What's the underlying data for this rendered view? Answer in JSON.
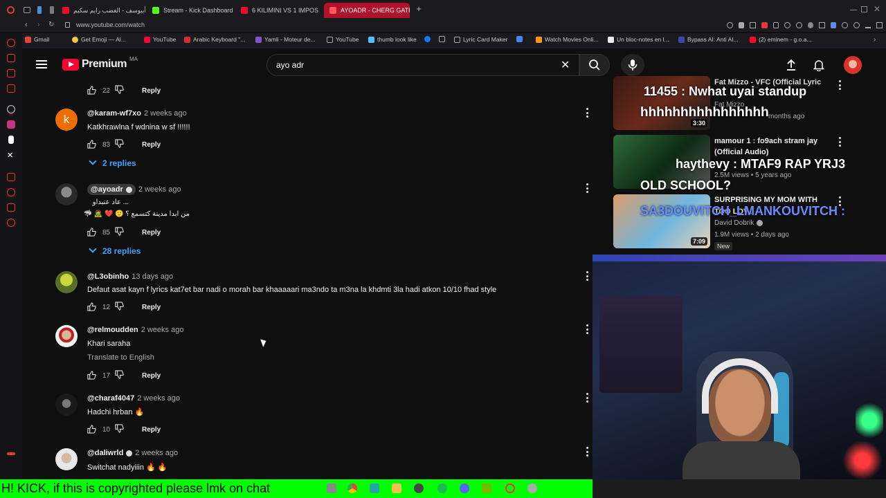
{
  "browser": {
    "tabs": [
      {
        "label": "أبيوسف - الغضب رايم سكيم"
      },
      {
        "label": "Stream - Kick Dashboard"
      },
      {
        "label": "6 KILIMINI VS 1 IMPOSTE"
      },
      {
        "label": "AYOADR - CHERG GATES"
      }
    ],
    "url": "www.youtube.com/watch",
    "bookmarks": [
      {
        "label": "Gmail"
      },
      {
        "label": "Get Emoji — Al..."
      },
      {
        "label": "YouTube"
      },
      {
        "label": "Arabic Keyboard \"..."
      },
      {
        "label": "Yamli - Moteur de..."
      },
      {
        "label": "YouTube"
      },
      {
        "label": "thumb look like"
      },
      {
        "label": "Lyric Card Maker"
      },
      {
        "label": "Watch Movies Onli..."
      },
      {
        "label": "Un bloc-notes en l..."
      },
      {
        "label": "Bypass AI: Anti AI..."
      },
      {
        "label": "(2) eminem - g.o.a..."
      }
    ]
  },
  "youtube": {
    "logo_text": "Premium",
    "region": "MA",
    "search_value": "ayo adr"
  },
  "comments": {
    "first_actions": {
      "likes": "22",
      "reply": "Reply"
    },
    "items": [
      {
        "handle": "@karam-wf7xo",
        "time": "2 weeks ago",
        "text": "Katkhrawlna f wdnina w sf !!!!!!",
        "likes": "83",
        "reply": "Reply",
        "avatar_letter": "k",
        "replies": "2 replies"
      },
      {
        "handle": "@ayoadr",
        "time": "2 weeks ago",
        "text": "... عاد عنبداو",
        "text2": "من ابدا مدينة كتسمع ؟ 🙂 ❤️ 🧟 🦈",
        "likes": "85",
        "reply": "Reply",
        "replies": "28 replies"
      },
      {
        "handle": "@L3obinho",
        "time": "13 days ago",
        "text": "Defaut asat kayn f lyrics kat7et bar nadi o morah bar khaaaaari ma3ndo ta m3na la khdmti 3la hadi atkon 10/10 fhad style",
        "likes": "12",
        "reply": "Reply"
      },
      {
        "handle": "@relmoudden",
        "time": "2 weeks ago",
        "text": "Khari saraha",
        "translate": "Translate to English",
        "likes": "17",
        "reply": "Reply"
      },
      {
        "handle": "@charaf4047",
        "time": "2 weeks ago",
        "text": "Hadchi hrban 🔥",
        "likes": "10",
        "reply": "Reply"
      },
      {
        "handle": "@daliwrld",
        "time": "2 weeks ago",
        "text": "Switchat nadyiiin 🔥 🔥"
      }
    ]
  },
  "related": [
    {
      "title": "Fat Mizzo - VFC (Official Lyric",
      "channel": "Fat Mizzo",
      "meta": "months ago",
      "duration": "3:30",
      "overlay": "11455 : Nwhat uyai standup",
      "overlay2": "hhhhhhhhhhhhhhhh"
    },
    {
      "title": "mamour 1 : fo9ach stram jay",
      "subtitle": "(Official Audio)",
      "meta": "2.5M views • 5 years ago",
      "overlay": "haythevy : MTAF9 RAP YRJ3",
      "overlay2": "OLD SCHOOL?"
    },
    {
      "title": "SURPRISING MY MOM WITH",
      "subtitle": "TOO LOV...",
      "channel": "David Dobrik",
      "meta": "1.9M views • 2 days ago",
      "badge": "New",
      "duration": "7:09",
      "overlay": "SA3DOUVITCH_LMANKOUVITCH :"
    }
  ],
  "ticker": "H! KICK, if this is copyrighted please lmk on chat",
  "colors": {
    "accent_blue": "#3ea6ff",
    "yt_red": "#ff0033",
    "ticker_bg": "#00ff00"
  }
}
